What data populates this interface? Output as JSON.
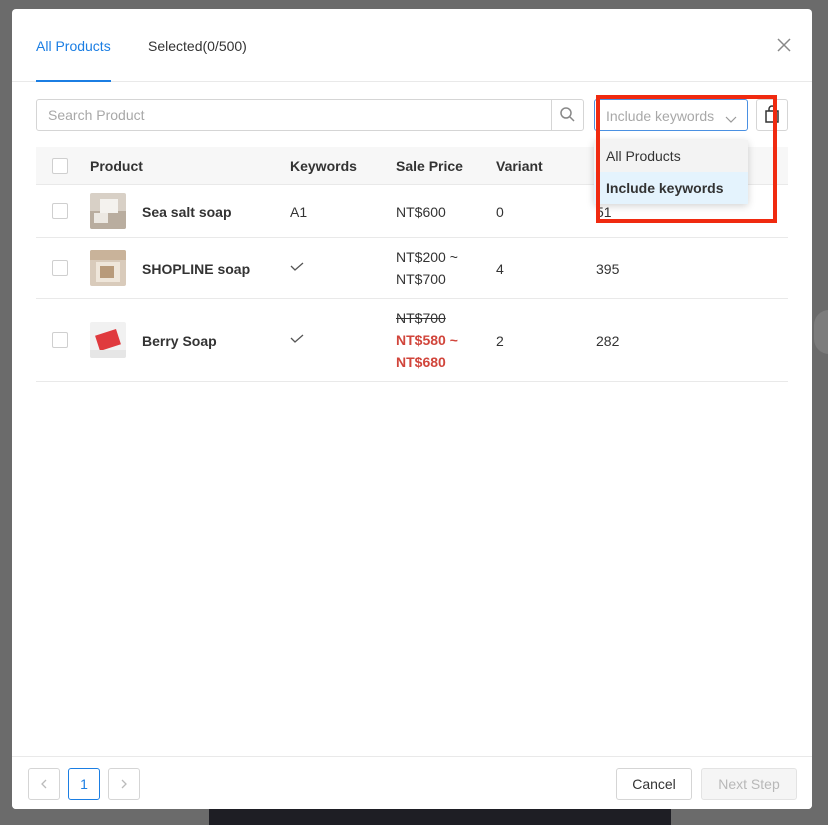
{
  "tabs": {
    "all_products": "All Products",
    "selected": "Selected(0/500)"
  },
  "search": {
    "placeholder": "Search Product",
    "value": ""
  },
  "filter": {
    "selected_label": "Include keywords",
    "options": [
      "All Products",
      "Include keywords"
    ]
  },
  "table": {
    "headers": {
      "product": "Product",
      "keywords": "Keywords",
      "sale_price": "Sale Price",
      "variant": "Variant"
    },
    "rows": [
      {
        "name": "Sea salt soap",
        "keywords": "A1",
        "price": "NT$600",
        "variant": "0",
        "stock": "51"
      },
      {
        "name": "SHOPLINE soap",
        "keywords_check": true,
        "price_line1": "NT$200 ~",
        "price_line2": "NT$700",
        "variant": "4",
        "stock": "395"
      },
      {
        "name": "Berry Soap",
        "keywords_check": true,
        "original_price": "NT$700",
        "sale_line1": "NT$580 ~",
        "sale_line2": "NT$680",
        "variant": "2",
        "stock": "282"
      }
    ]
  },
  "pagination": {
    "current_page": "1"
  },
  "footer": {
    "cancel": "Cancel",
    "next_step": "Next Step"
  },
  "colors": {
    "accent": "#1b7ee3",
    "sale_red": "#d1453b",
    "highlight": "#f02a10"
  }
}
